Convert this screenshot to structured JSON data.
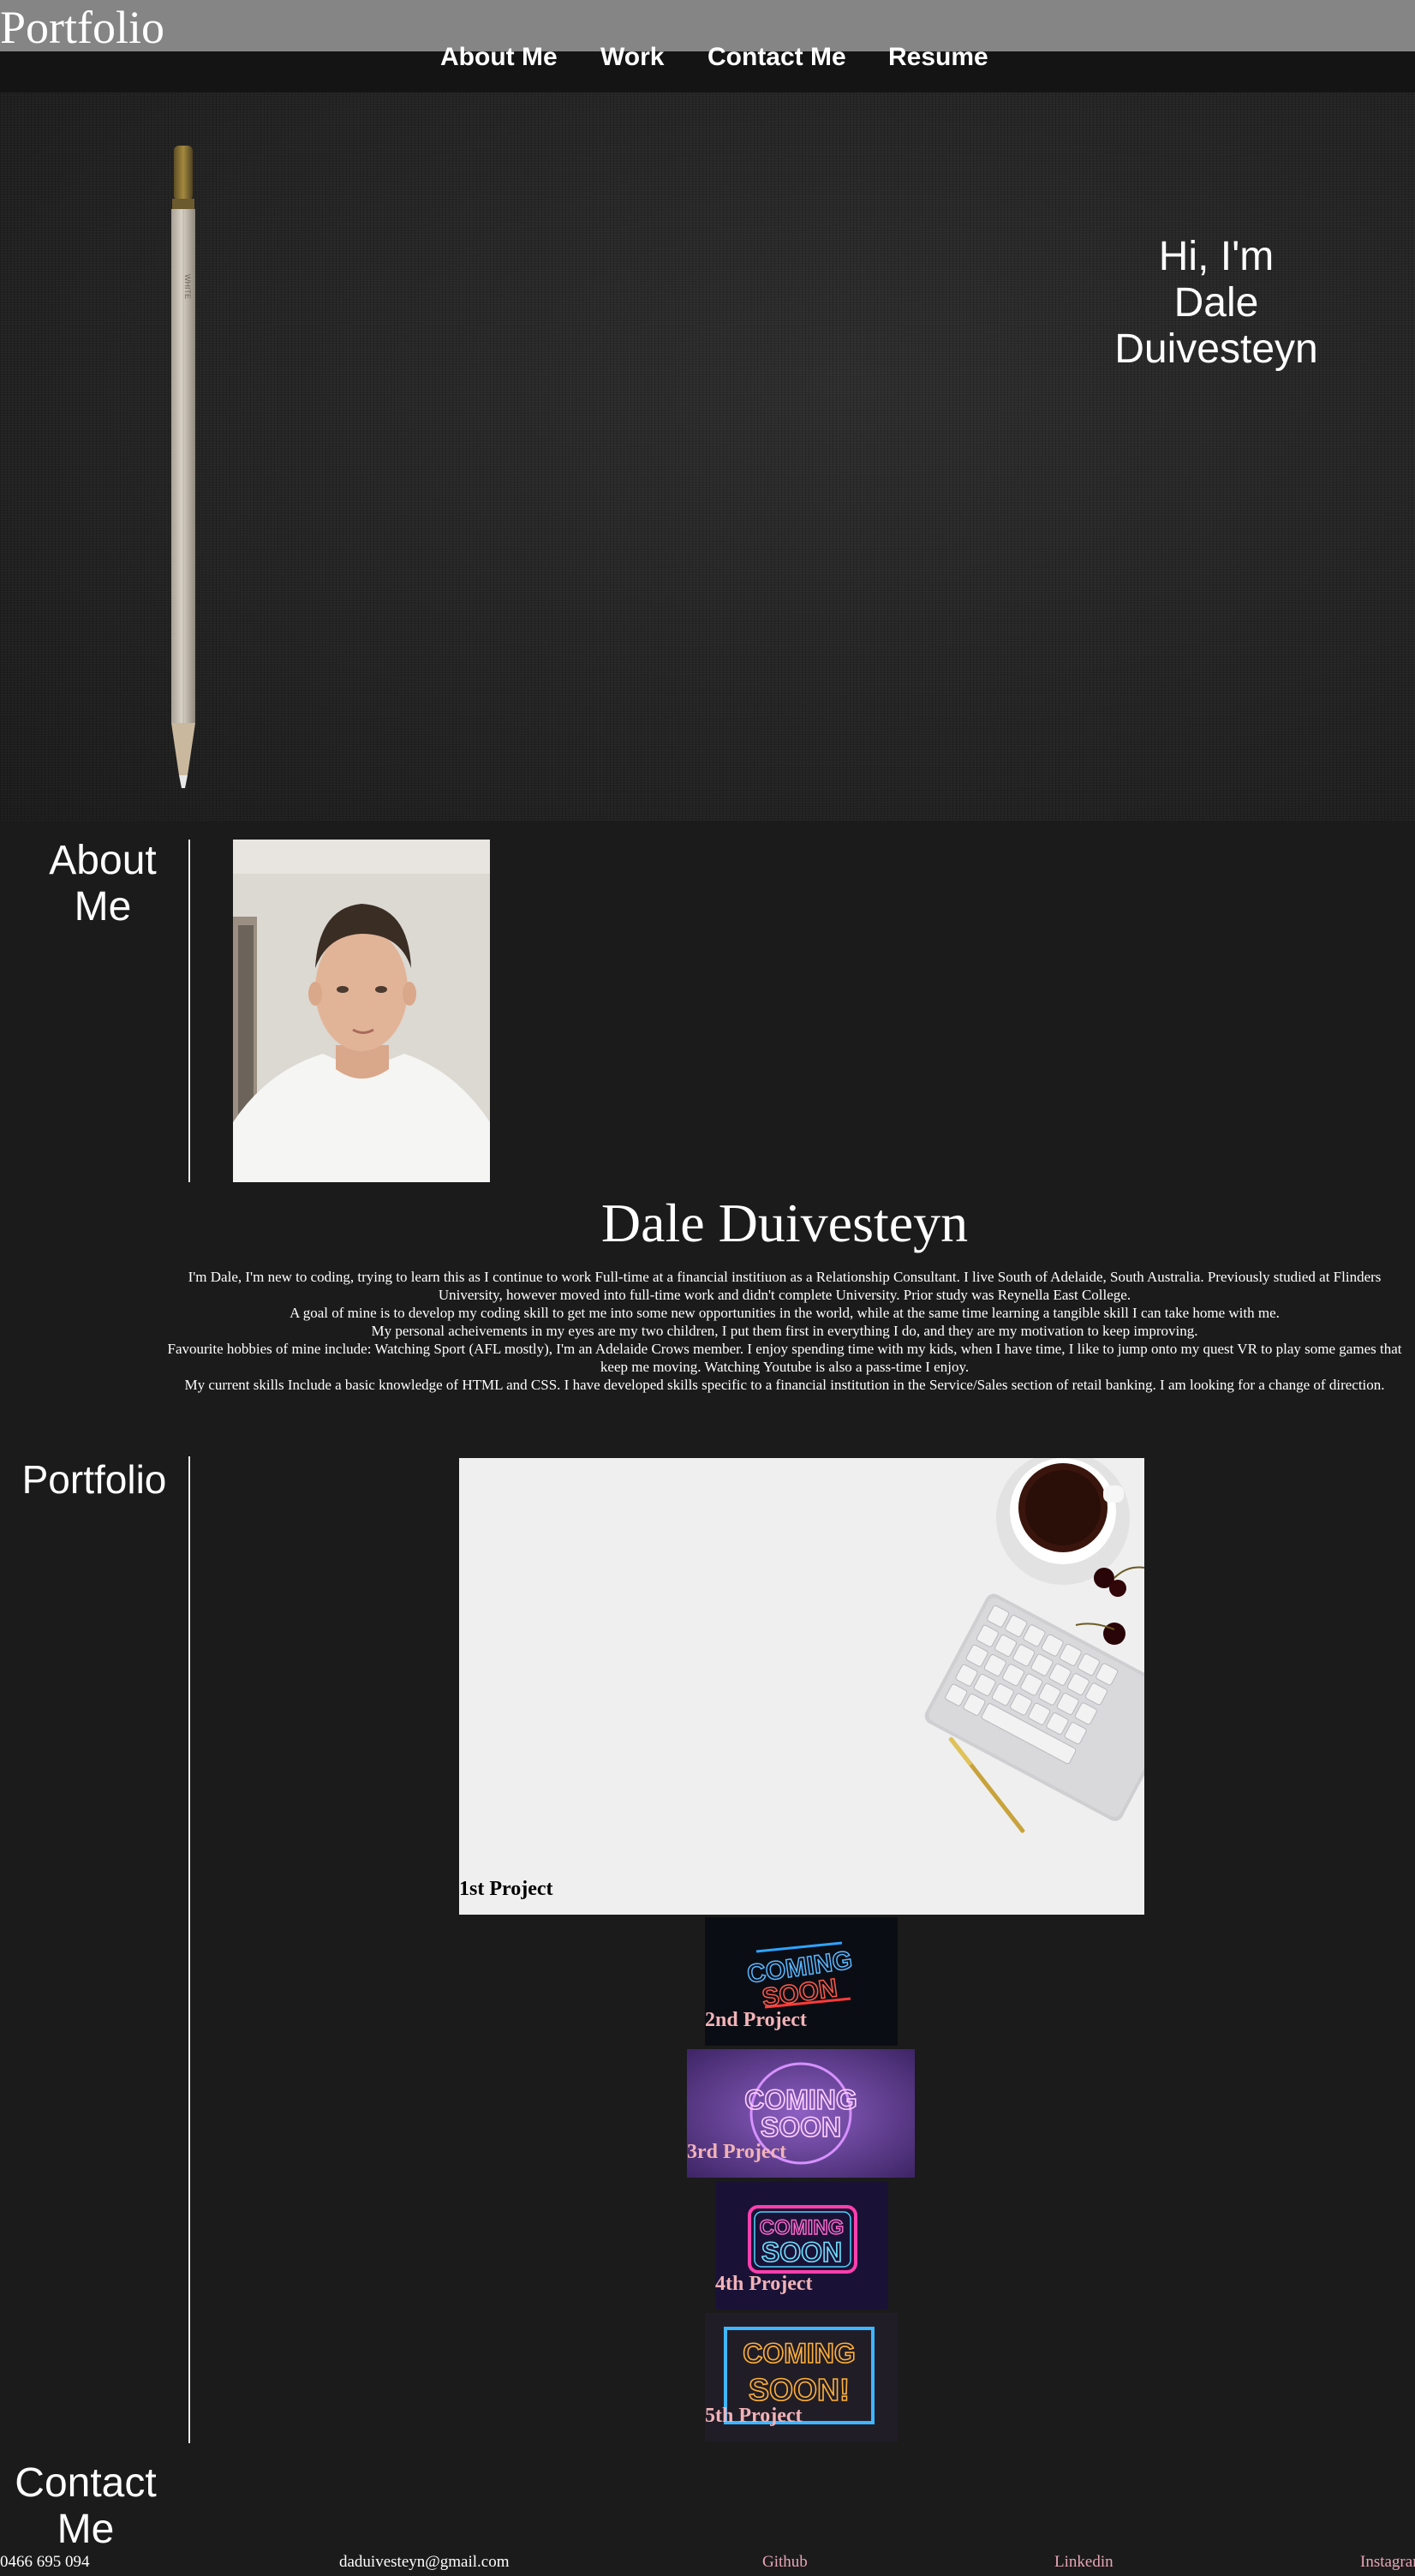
{
  "header": {
    "brand": "Portfolio",
    "nav": [
      "About Me",
      "Work",
      "Contact Me",
      "Resume"
    ]
  },
  "hero": {
    "greeting_lines": [
      "Hi, I'm",
      "Dale",
      "Duivesteyn"
    ]
  },
  "about": {
    "heading_lines": [
      "About",
      "Me"
    ],
    "name": "Dale Duivesteyn",
    "bio": [
      "I'm Dale, I'm new to coding, trying to learn this as I continue to work Full-time at a financial institiuon as a Relationship Consultant. I live South of Adelaide, South Australia. Previously studied at Flinders University, however moved into full-time work and didn't complete University. Prior study was Reynella East College.",
      "A goal of mine is to develop my coding skill to get me into some new opportunities in the world, while at the same time learning a tangible skill I can take home with me.",
      "My personal acheivements in my eyes are my two children, I put them first in everything I do, and they are my motivation to keep improving.",
      "Favourite hobbies of mine include: Watching Sport (AFL mostly), I'm an Adelaide Crows member. I enjoy spending time with my kids, when I have time, I like to jump onto my quest VR to play some games that keep me moving. Watching Youtube is also a pass-time I enjoy.",
      "My current skills Include a basic knowledge of HTML and CSS. I have developed skills specific to a financial institution in the Service/Sales section of retail banking. I am looking for a change of direction."
    ]
  },
  "portfolio": {
    "heading": "Portfolio",
    "projects": [
      {
        "label": "1st Project"
      },
      {
        "label": "2nd Project",
        "sign_lines": [
          "COMING",
          "SOON"
        ]
      },
      {
        "label": "3rd Project",
        "sign_lines": [
          "COMING",
          "SOON"
        ]
      },
      {
        "label": "4th Project",
        "sign_lines": [
          "COMING",
          "SOON"
        ]
      },
      {
        "label": "5th Project",
        "sign_lines": [
          "COMING",
          "SOON!"
        ]
      }
    ]
  },
  "contact": {
    "heading_lines": [
      "Contact",
      "Me"
    ],
    "phone": "0466 695 094",
    "email": "daduivesteyn@gmail.com",
    "links": [
      "Github",
      "Linkedin",
      "Instagram"
    ]
  },
  "colors": {
    "page_bg": "#1b1b1b",
    "header_bg": "#858585",
    "nav_bg": "#141414",
    "link_pink": "#e8a5b8",
    "divider": "#e9e9e9"
  },
  "icons": [
    "pencil-image",
    "profile-photo",
    "desk-keyboard-coffee-image"
  ]
}
